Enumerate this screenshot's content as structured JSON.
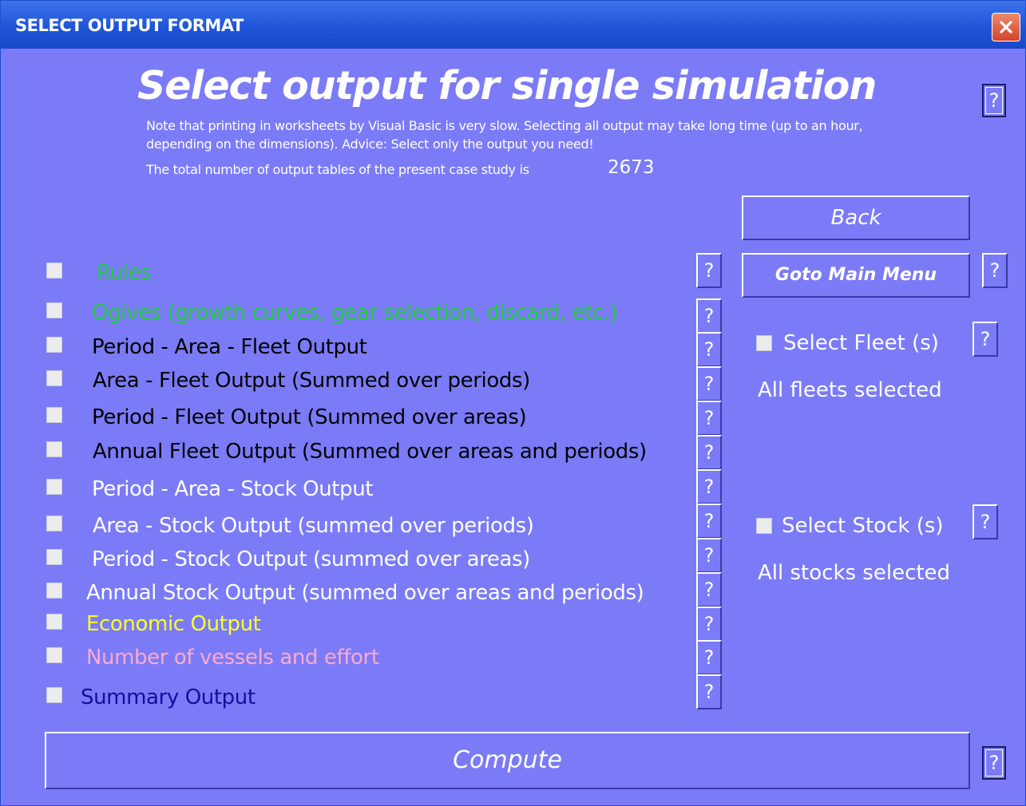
{
  "window": {
    "title": "SELECT OUTPUT FORMAT"
  },
  "header": {
    "heading": "Select output for single simulation",
    "note": "Note that printing in worksheets by Visual Basic is very slow. Selecting all output may take long time (up to an hour, depending on the dimensions). Advice: Select only the output you need!",
    "total_label": "The total number of output tables of the present case study is",
    "total_value": "2673"
  },
  "help_label": "?",
  "buttons": {
    "back": "Back",
    "goto_main_menu": "Goto Main Menu",
    "compute": "Compute"
  },
  "options": [
    {
      "label": "Rules",
      "color": "#22cc44",
      "checked": false
    },
    {
      "label": "Ogives (growth curves, gear selection, discard, etc.)",
      "color": "#22cc44",
      "checked": false
    },
    {
      "label": "Period - Area - Fleet Output",
      "color": "#000000",
      "checked": false
    },
    {
      "label": "Area - Fleet Output (Summed over periods)",
      "color": "#000000",
      "checked": false
    },
    {
      "label": "Period - Fleet Output (Summed over areas)",
      "color": "#000000",
      "checked": false
    },
    {
      "label": "Annual Fleet Output (Summed over areas and periods)",
      "color": "#000000",
      "checked": false
    },
    {
      "label": "Period - Area - Stock Output",
      "color": "#ffffff",
      "checked": false
    },
    {
      "label": "Area - Stock Output (summed over periods)",
      "color": "#ffffff",
      "checked": false
    },
    {
      "label": "Period - Stock Output (summed over areas)",
      "color": "#ffffff",
      "checked": false
    },
    {
      "label": "Annual Stock Output (summed over areas and periods)",
      "color": "#ffffff",
      "checked": false
    },
    {
      "label": "Economic Output",
      "color": "#ffff22",
      "checked": false
    },
    {
      "label": "Number of vessels and effort",
      "color": "#ffaacc",
      "checked": false
    },
    {
      "label": "Summary Output",
      "color": "#1010a0",
      "checked": false
    }
  ],
  "fleet": {
    "label": "Select Fleet  (s)",
    "status": "All fleets selected"
  },
  "stock": {
    "label": "Select Stock  (s)",
    "status": "All stocks selected"
  }
}
